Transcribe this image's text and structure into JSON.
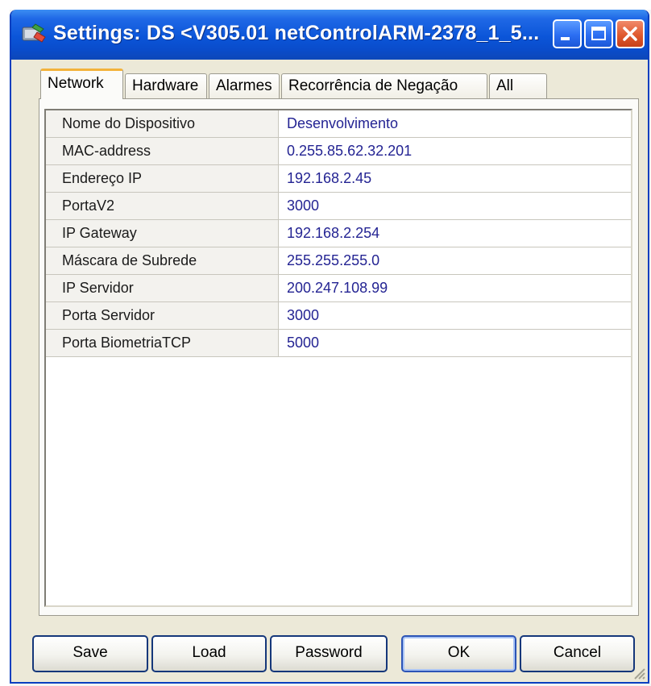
{
  "window": {
    "title": "Settings: DS <V305.01 netControlARM-2378_1_5..."
  },
  "title_buttons": {
    "minimize": "minimize",
    "maximize": "maximize",
    "close": "close"
  },
  "tabs": [
    {
      "label": "Network",
      "active": true
    },
    {
      "label": "Hardware",
      "active": false
    },
    {
      "label": "Alarmes",
      "active": false
    },
    {
      "label": "Recorrência de Negação",
      "active": false
    },
    {
      "label": "All",
      "active": false
    }
  ],
  "properties": [
    {
      "key": "Nome do Dispositivo",
      "value": "Desenvolvimento"
    },
    {
      "key": "MAC-address",
      "value": "0.255.85.62.32.201"
    },
    {
      "key": "Endereço IP",
      "value": "192.168.2.45"
    },
    {
      "key": "PortaV2",
      "value": "3000"
    },
    {
      "key": "IP Gateway",
      "value": "192.168.2.254"
    },
    {
      "key": "Máscara de Subrede",
      "value": "255.255.255.0"
    },
    {
      "key": "IP Servidor",
      "value": "200.247.108.99"
    },
    {
      "key": "Porta Servidor",
      "value": "3000"
    },
    {
      "key": "Porta BiometriaTCP",
      "value": "5000"
    }
  ],
  "buttons": {
    "save": "Save",
    "load": "Load",
    "password": "Password",
    "ok": "OK",
    "cancel": "Cancel"
  },
  "colors": {
    "titlebar": "#0b55d8",
    "value_text": "#242493",
    "active_tab_accent": "#f3b33c",
    "close_button": "#e05a2e"
  }
}
